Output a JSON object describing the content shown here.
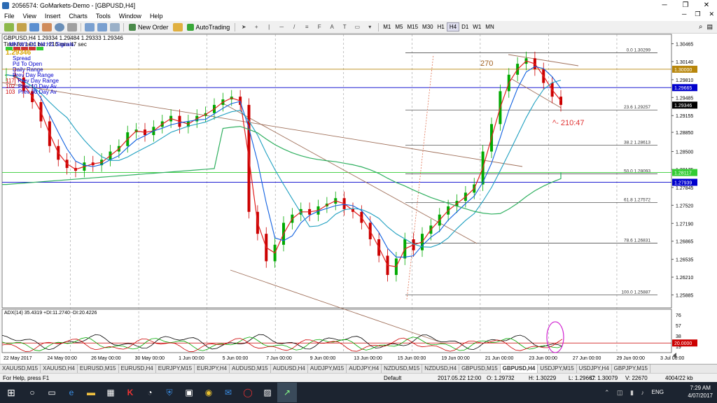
{
  "window": {
    "title": "2056574: GoMarkets-Demo - [GBPUSD,H4]"
  },
  "menu": [
    "File",
    "View",
    "Insert",
    "Charts",
    "Tools",
    "Window",
    "Help"
  ],
  "toolbar": {
    "new_order": "New Order",
    "autotrading": "AutoTrading",
    "timeframes": [
      "M1",
      "M5",
      "M15",
      "M30",
      "H1",
      "H4",
      "D1",
      "W1",
      "MN"
    ],
    "active_tf": "H4"
  },
  "chart": {
    "header": "GBPUSD,H4 1.29334 1.29484 1.29333 1.29346",
    "timer": "Time for next bar: 210 min 47 sec",
    "panel_title": "MN W1 D1 H4 H1 Signals",
    "spread_price": "1.29346",
    "legend": [
      {
        "label": "Spread",
        "color": "#00c"
      },
      {
        "label": "Pd To Open",
        "color": "#00c"
      },
      {
        "label": "Daily Range",
        "color": "#00c"
      },
      {
        "label": "Prev Day Range",
        "color": "#00c"
      },
      {
        "value": "117",
        "label": "Prev Day Range",
        "color": "#c00"
      },
      {
        "value": "102",
        "label": "Prev 10 Day Av",
        "color": "#c00"
      },
      {
        "value": "103",
        "label": "Prev 30 Day Av",
        "color": "#c00"
      }
    ],
    "annotation_pips": "270",
    "annotation_timer": "^- 210:47",
    "fib_levels": [
      {
        "label": "0.0  1.30299",
        "price": 1.30299
      },
      {
        "label": "23.6  1.29257",
        "price": 1.29257
      },
      {
        "label": "38.2  1.28613",
        "price": 1.28613
      },
      {
        "label": "50.0  1.28093",
        "price": 1.28093
      },
      {
        "label": "61.8  1.27572",
        "price": 1.27572
      },
      {
        "label": "78.6  1.26831",
        "price": 1.26831
      },
      {
        "label": "100.0  1.25887",
        "price": 1.25887
      }
    ],
    "price_ticks": [
      "1.30465",
      "1.30140",
      "1.29810",
      "1.29485",
      "1.29155",
      "1.28850",
      "1.28500",
      "1.28175",
      "1.27845",
      "1.27520",
      "1.27190",
      "1.26865",
      "1.26535",
      "1.26210",
      "1.25885"
    ],
    "price_range": [
      1.2565,
      1.3065
    ],
    "price_boxes": [
      {
        "label": "1.30000",
        "price": 1.3,
        "bg": "#b8860b"
      },
      {
        "label": "1.29665",
        "price": 1.29665,
        "bg": "#0000cc"
      },
      {
        "label": "1.29346",
        "price": 1.29346,
        "bg": "#000000"
      },
      {
        "label": "1.28117",
        "price": 1.28117,
        "bg": "#33cc33"
      },
      {
        "label": "1.27939",
        "price": 1.27939,
        "bg": "#0000cc"
      }
    ],
    "date_ticks": [
      "22 May 2017",
      "24 May 00:00",
      "26 May 00:00",
      "30 May 00:00",
      "1 Jun 00:00",
      "5 Jun 00:00",
      "7 Jun 00:00",
      "9 Jun 00:00",
      "13 Jun 00:00",
      "15 Jun 00:00",
      "19 Jun 00:00",
      "21 Jun 00:00",
      "23 Jun 00:00",
      "27 Jun 00:00",
      "29 Jun 00:00",
      "3 Jul 00:00"
    ],
    "adx_label": "ADX(14) 35.4319 +DI:11.2740 -DI:20.4226",
    "adx_ticks": [
      "76",
      "57",
      "38",
      "19"
    ],
    "adx_box": "20.0000",
    "close_series": [
      1.299,
      1.2985,
      1.296,
      1.294,
      1.2905,
      1.286,
      1.2835,
      1.282,
      1.2815,
      1.283,
      1.2825,
      1.2835,
      1.285,
      1.286,
      1.2885,
      1.289,
      1.288,
      1.2895,
      1.2905,
      1.2915,
      1.2895,
      1.2905,
      1.2915,
      1.292,
      1.2935,
      1.2945,
      1.295,
      1.2935,
      1.274,
      1.27,
      1.265,
      1.268,
      1.272,
      1.2735,
      1.2745,
      1.2735,
      1.275,
      1.2755,
      1.2765,
      1.2745,
      1.274,
      1.272,
      1.269,
      1.266,
      1.2625,
      1.2655,
      1.269,
      1.267,
      1.27,
      1.2715,
      1.2735,
      1.275,
      1.276,
      1.2775,
      1.279,
      1.285,
      1.29,
      1.296,
      1.299,
      1.301,
      1.302,
      1.3,
      1.2975,
      1.295,
      1.2935
    ]
  },
  "tabs": [
    "XAUUSD,M15",
    "XAUUSD,H4",
    "EURUSD,M15",
    "EURUSD,H4",
    "EURJPY,M15",
    "EURJPY,H4",
    "AUDUSD,M15",
    "AUDUSD,H4",
    "AUDJPY,M15",
    "AUDJPY,H4",
    "NZDUSD,M15",
    "NZDUSD,H4",
    "GBPUSD,M15",
    "GBPUSD,H4",
    "USDJPY,M15",
    "USDJPY,H4",
    "GBPJPY,M15"
  ],
  "active_tab": "GBPUSD,H4",
  "status": {
    "help": "For Help, press F1",
    "profile": "Default",
    "time": "2017.05.22 12:00",
    "open": "O: 1.29732",
    "high": "H: 1.30229",
    "low": "L: 1.29667",
    "close": "C: 1.30079",
    "volume": "V: 22670",
    "traffic": "4004/22 kb"
  },
  "taskbar": {
    "time": "7:29 AM",
    "date": "4/07/2017",
    "lang": "ENG"
  }
}
